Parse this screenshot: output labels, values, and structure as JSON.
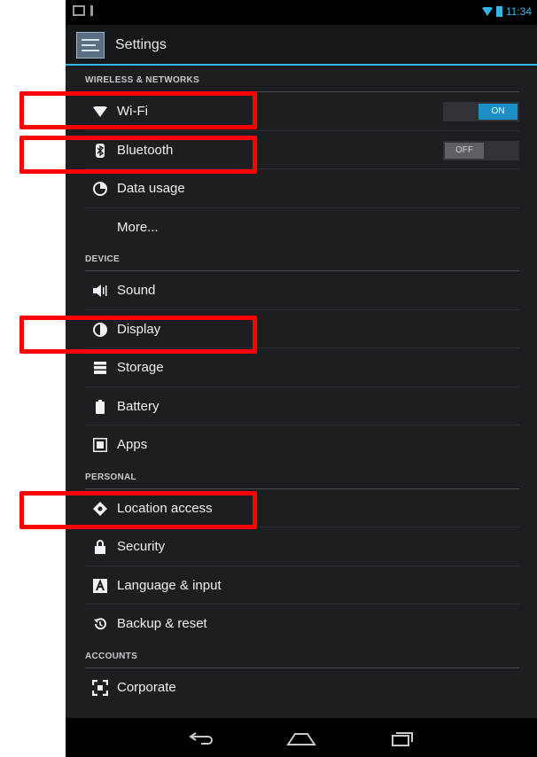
{
  "status_bar": {
    "time": "11:34",
    "icons": [
      "picture-icon",
      "alert-icon",
      "wifi-signal-icon",
      "battery-icon"
    ]
  },
  "action_bar": {
    "title": "Settings",
    "icon": "settings-app-icon"
  },
  "sections": [
    {
      "header": "WIRELESS & NETWORKS",
      "items": [
        {
          "label": "Wi-Fi",
          "icon": "wifi-icon",
          "toggle": "ON"
        },
        {
          "label": "Bluetooth",
          "icon": "bluetooth-icon",
          "toggle": "OFF"
        },
        {
          "label": "Data usage",
          "icon": "data-usage-icon"
        },
        {
          "label": "More...",
          "icon": ""
        }
      ]
    },
    {
      "header": "DEVICE",
      "items": [
        {
          "label": "Sound",
          "icon": "sound-icon"
        },
        {
          "label": "Display",
          "icon": "display-icon"
        },
        {
          "label": "Storage",
          "icon": "storage-icon"
        },
        {
          "label": "Battery",
          "icon": "battery-icon"
        },
        {
          "label": "Apps",
          "icon": "apps-icon"
        }
      ]
    },
    {
      "header": "PERSONAL",
      "items": [
        {
          "label": "Location access",
          "icon": "location-icon"
        },
        {
          "label": "Security",
          "icon": "lock-icon"
        },
        {
          "label": "Language & input",
          "icon": "language-icon"
        },
        {
          "label": "Backup & reset",
          "icon": "backup-icon"
        }
      ]
    },
    {
      "header": "ACCOUNTS",
      "items": [
        {
          "label": "Corporate",
          "icon": "corporate-icon"
        }
      ]
    }
  ],
  "nav_bar": {
    "buttons": [
      "back-icon",
      "home-icon",
      "recent-apps-icon"
    ]
  },
  "highlights": [
    "Wi-Fi",
    "Bluetooth",
    "Display",
    "Location access"
  ],
  "colors": {
    "accent": "#33b5e5",
    "highlight": "#ff0000",
    "background": "#1d1e22"
  }
}
